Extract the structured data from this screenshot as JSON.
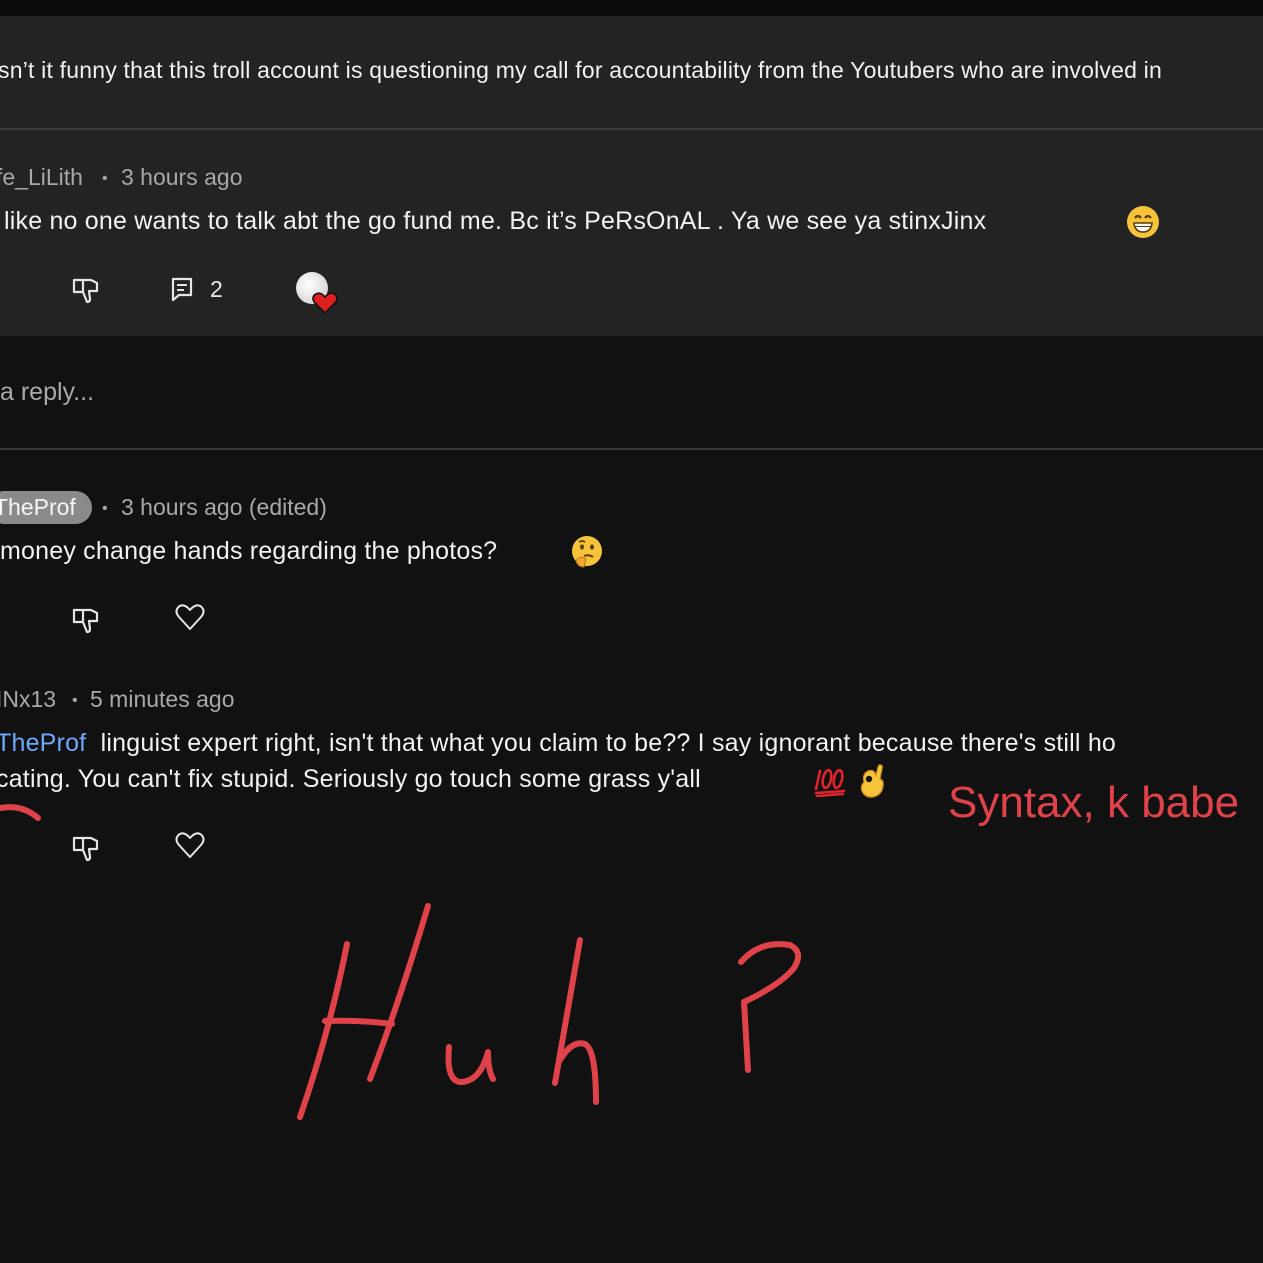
{
  "thread": {
    "top_comment_text": "sn’t it funny that this troll account is questioning my call for accountability from the Youtubers who are involved in",
    "reply1": {
      "username": "fe_LiLith",
      "time": "3 hours ago",
      "text": "like no one wants to talk abt the go fund me. Bc it’s PeRsOnAL . Ya we see ya stinxJinx",
      "reply_count": "2"
    },
    "reply_placeholder": "a reply...",
    "comment2": {
      "username": "TheProf",
      "time": "3 hours ago (edited)",
      "text": "money change hands regarding the photos?"
    },
    "comment3": {
      "username": "INx13",
      "time": "5 minutes ago",
      "mention": "TheProf",
      "line1": "linguist expert right, isn't that what you claim to be?? I say ignorant because there's still ho",
      "line2": "cating. You can't fix stupid. Seriously go touch some grass y'all"
    }
  },
  "annotations": {
    "typed": "Syntax, k babe",
    "handwritten": "Huh ?"
  },
  "colors": {
    "background": "#111111",
    "panel": "#232323",
    "mention": "#6fa8ff",
    "annotation_red": "#e0424a"
  },
  "icons": [
    "dislike-icon",
    "comment-icon",
    "heart-outline-icon",
    "heart-badge-icon"
  ]
}
